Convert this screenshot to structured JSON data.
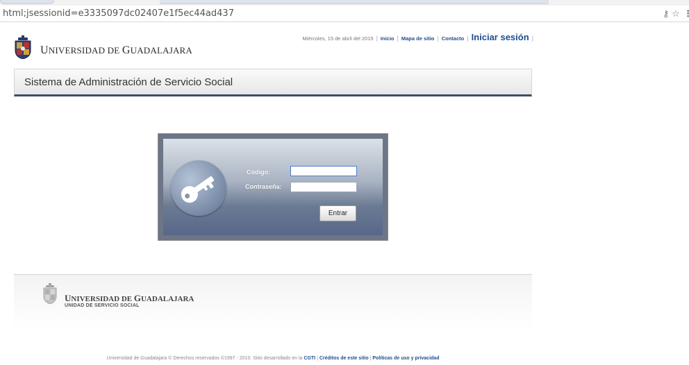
{
  "browser": {
    "url": "html;jsessionid=e3335097dc02407e1f5ec44ad437",
    "icons": [
      "key-icon",
      "star-icon",
      "menu-icon"
    ]
  },
  "header": {
    "logo_initial_1": "U",
    "logo_rest_1": "NIVERSIDAD DE ",
    "logo_initial_2": "G",
    "logo_rest_2": "UADALAJARA",
    "date": "Miércoles, 15 de abril del 2015",
    "links": {
      "inicio": "Inicio",
      "mapa": "Mapa de sitio",
      "contacto": "Contacto",
      "login": "Iniciar sesión"
    }
  },
  "title_bar": {
    "title": "Sistema de Administración de Servicio Social"
  },
  "login": {
    "codigo_label": "Código:",
    "codigo_value": "",
    "password_label": "Contraseña:",
    "password_value": "",
    "submit_label": "Entrar"
  },
  "footer": {
    "uni_initial_1": "U",
    "uni_rest_1": "NIVERSIDAD DE ",
    "uni_initial_2": "G",
    "uni_rest_2": "UADALAJARA",
    "unit": "UNIDAD DE SERVICIO SOCIAL",
    "copyright_prefix": "Universidad de Guadalajara © Derechos reservados ©1997 - 2010. Sitio desarrollado en la ",
    "cgti": "CGTI",
    "creditos": "Créditos de este sitio",
    "politicas": "Políticas de uso y privacidad"
  },
  "colors": {
    "link_blue": "#1d4e8f",
    "title_underline": "#3d4d66",
    "login_panel": "#6c7687"
  }
}
